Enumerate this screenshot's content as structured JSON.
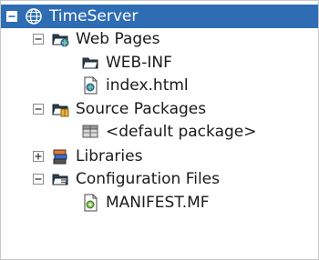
{
  "tree": {
    "project": {
      "label": "TimeServer",
      "toggle_icon": "minus-icon",
      "icon": "globe-icon"
    },
    "web_pages": {
      "label": "Web Pages",
      "toggle_icon": "minus-icon",
      "icon": "web-folder-icon"
    },
    "web_inf": {
      "label": "WEB-INF",
      "icon": "folder-icon"
    },
    "index_html": {
      "label": "index.html",
      "icon": "html-file-icon"
    },
    "source_packages": {
      "label": "Source Packages",
      "toggle_icon": "minus-icon",
      "icon": "package-folder-icon"
    },
    "default_package": {
      "label": "<default package>",
      "icon": "package-icon"
    },
    "libraries": {
      "label": "Libraries",
      "toggle_icon": "plus-icon",
      "icon": "library-icon"
    },
    "config_files": {
      "label": "Configuration Files",
      "toggle_icon": "minus-icon",
      "icon": "config-folder-icon"
    },
    "manifest": {
      "label": "MANIFEST.MF",
      "icon": "manifest-file-icon"
    }
  },
  "colors": {
    "selection": "#2e6db3",
    "text": "#1a1a1a",
    "border": "#c8c8c8"
  }
}
